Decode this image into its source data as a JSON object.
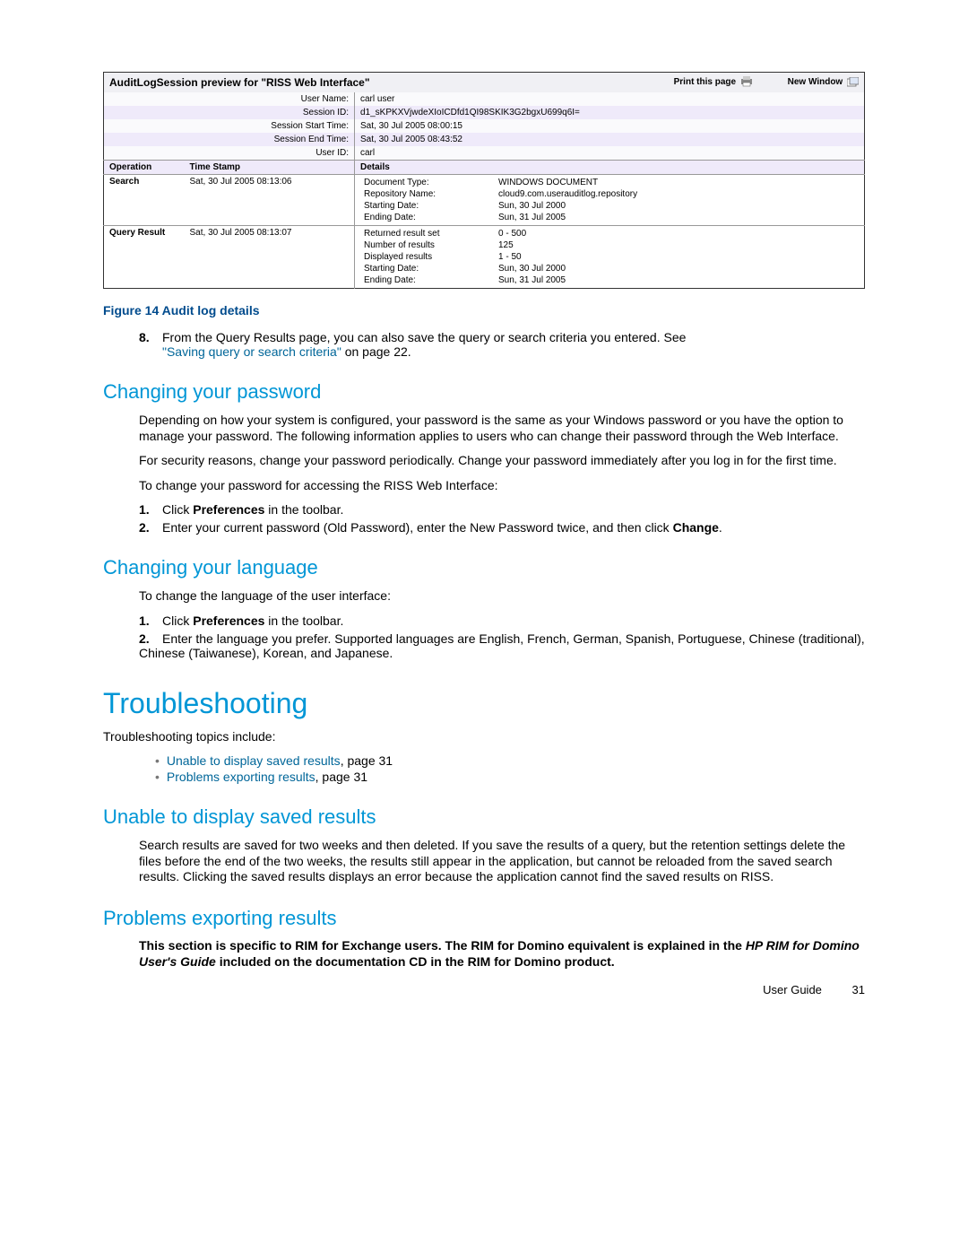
{
  "screenshot": {
    "title": "AuditLogSession preview for \"RISS Web Interface\"",
    "printLink": "Print this page",
    "newWindowLink": "New Window",
    "meta": [
      {
        "label": "User Name:",
        "value": "carl  user"
      },
      {
        "label": "Session ID:",
        "value": "d1_sKPKXVjwdeXIoICDfd1QI98SKIK3G2bgxU699q6I="
      },
      {
        "label": "Session Start Time:",
        "value": "Sat, 30 Jul 2005 08:00:15"
      },
      {
        "label": "Session End Time:",
        "value": "Sat, 30 Jul 2005 08:43:52"
      },
      {
        "label": "User ID:",
        "value": "carl"
      }
    ],
    "columns": {
      "op": "Operation",
      "ts": "Time Stamp",
      "details": "Details"
    },
    "rows": [
      {
        "op": "Search",
        "ts": "Sat, 30 Jul 2005 08:13:06",
        "details": [
          {
            "k": "Document Type:",
            "v": "WINDOWS DOCUMENT"
          },
          {
            "k": "Repository Name:",
            "v": "cloud9.com.userauditlog.repository"
          },
          {
            "k": "Starting Date:",
            "v": "Sun, 30 Jul 2000"
          },
          {
            "k": "Ending Date:",
            "v": "Sun, 31 Jul 2005"
          }
        ]
      },
      {
        "op": "Query Result",
        "ts": "Sat, 30 Jul 2005 08:13:07",
        "details": [
          {
            "k": "Returned result set",
            "v": "0 - 500"
          },
          {
            "k": "Number of results",
            "v": "125"
          },
          {
            "k": "Displayed results",
            "v": "1 - 50"
          },
          {
            "k": "Starting Date:",
            "v": "Sun, 30 Jul 2000"
          },
          {
            "k": "Ending Date:",
            "v": "Sun, 31 Jul 2005"
          }
        ]
      }
    ]
  },
  "caption": "Figure 14 Audit log details",
  "step8": {
    "num": "8.",
    "text1": "From the Query Results page, you can also save the query or search criteria you entered.  See ",
    "link": "\"Saving query or search criteria\"",
    "text2": " on page 22."
  },
  "sec_password": {
    "title": "Changing your password",
    "p1": "Depending on how your system is configured, your password is the same as your Windows password or you have the option to manage your password.  The following information applies to users who can change their password through the Web Interface.",
    "p2": "For security reasons, change your password periodically.  Change your password immediately after you log in for the first time.",
    "p3": "To change your password for accessing the RISS Web Interface:",
    "steps": [
      {
        "num": "1.",
        "pre": "Click ",
        "bold": "Preferences",
        "post": " in the toolbar."
      },
      {
        "num": "2.",
        "pre": "Enter your current password (Old Password), enter the New Password twice, and then click ",
        "bold": "Change",
        "post": "."
      }
    ]
  },
  "sec_language": {
    "title": "Changing your language",
    "p1": "To change the language of the user interface:",
    "steps": [
      {
        "num": "1.",
        "pre": "Click ",
        "bold": "Preferences",
        "post": " in the toolbar."
      },
      {
        "num": "2.",
        "pre": "Enter the language you prefer.  Supported languages are English, French, German, Spanish, Portuguese, Chinese (traditional), Chinese (Taiwanese), Korean, and Japanese.",
        "bold": "",
        "post": ""
      }
    ]
  },
  "troubleshoot": {
    "title": "Troubleshooting",
    "intro": "Troubleshooting topics include:",
    "bullets": [
      {
        "link": "Unable to display saved results",
        "tail": ", page 31"
      },
      {
        "link": "Problems exporting results",
        "tail": ", page 31"
      }
    ]
  },
  "sec_unable": {
    "title": "Unable to display saved results",
    "p1": "Search results are saved for two weeks and then deleted.  If you save the results of a query, but the retention settings delete the files before the end of the two weeks, the results still appear in the application, but cannot be reloaded from the saved search results. Clicking the saved results displays an error because the application cannot find the saved results on RISS."
  },
  "sec_export": {
    "title": "Problems exporting results",
    "note": {
      "a": "This section is specific to RIM for Exchange users.  The RIM for Domino equivalent is explained in the ",
      "b": "HP RIM for Domino User's Guide",
      "c": " included on the documentation CD in the RIM for Domino product."
    }
  },
  "footer": {
    "label": "User Guide",
    "page": "31"
  }
}
